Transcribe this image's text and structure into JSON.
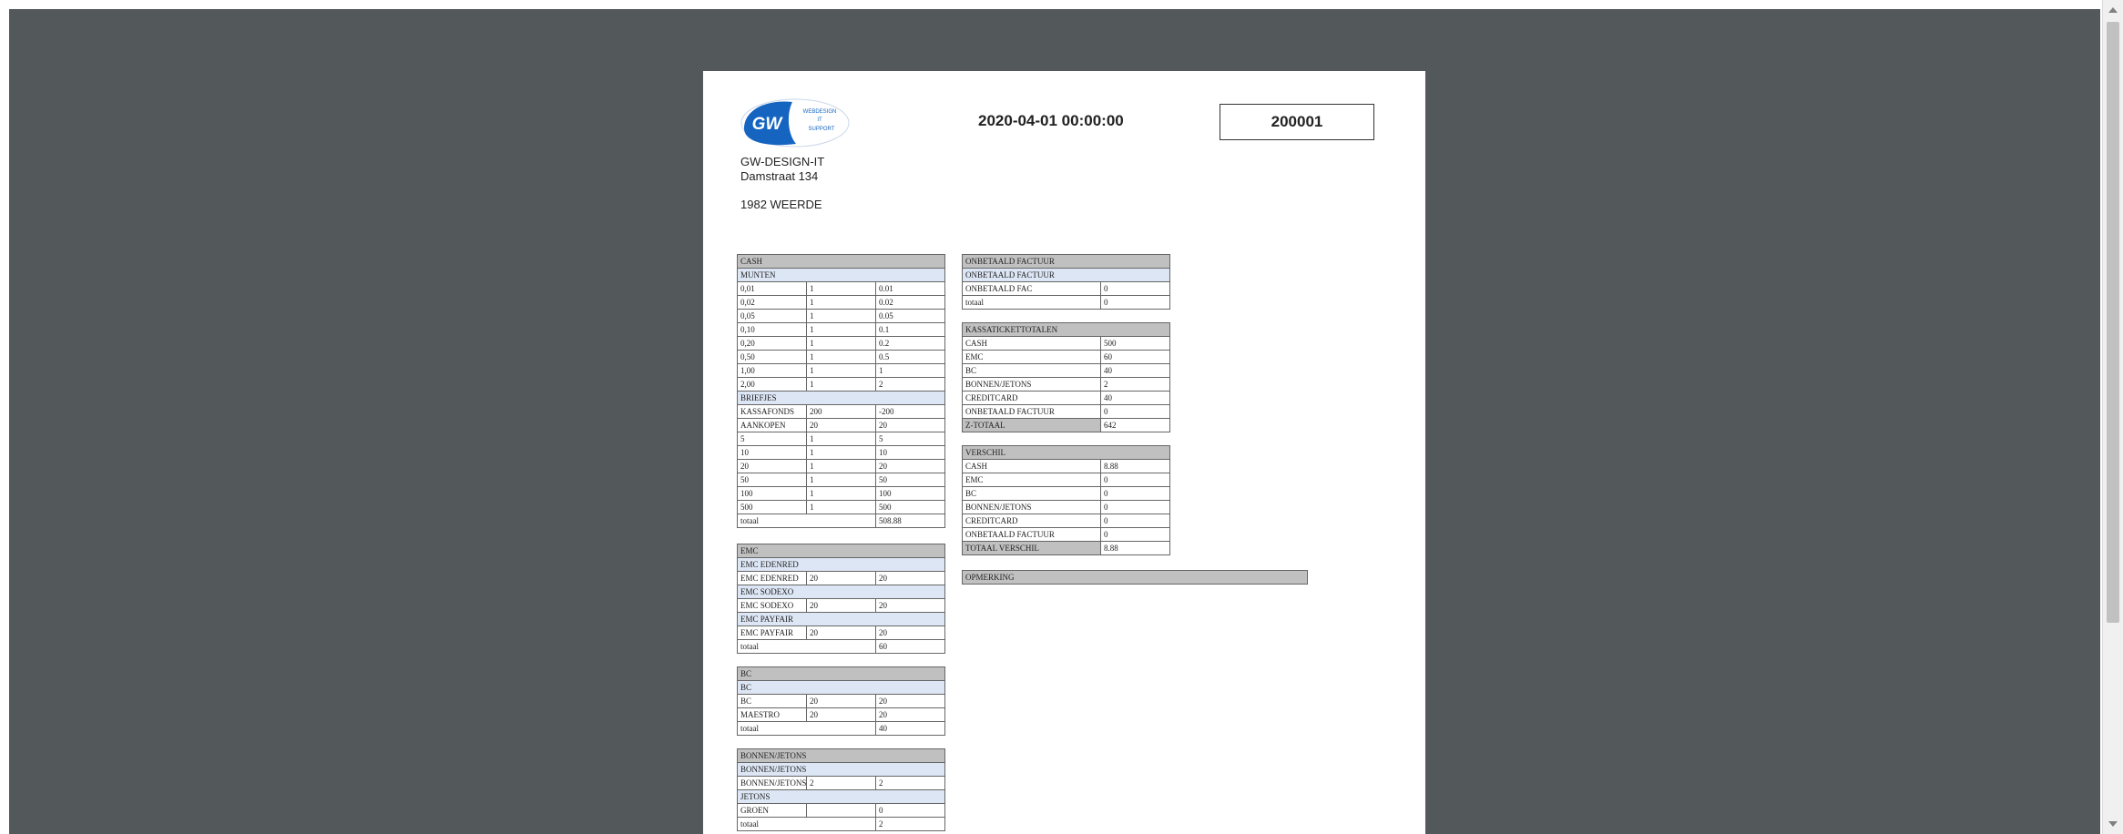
{
  "header": {
    "company": "GW-DESIGN-IT",
    "street": "Damstraat 134",
    "city": "1982 WEERDE",
    "datetime": "2020-04-01 00:00:00",
    "number": "200001"
  },
  "logo": {
    "mark": "GW",
    "line1": "WEBDESIGN",
    "line2": "IT",
    "line3": "SUPPORT",
    "color": "#1565c0"
  },
  "cash": {
    "title": "CASH",
    "munten_label": "MUNTEN",
    "munten": [
      [
        "0,01",
        "1",
        "0.01"
      ],
      [
        "0,02",
        "1",
        "0.02"
      ],
      [
        "0,05",
        "1",
        "0.05"
      ],
      [
        "0,10",
        "1",
        "0.1"
      ],
      [
        "0,20",
        "1",
        "0.2"
      ],
      [
        "0,50",
        "1",
        "0.5"
      ],
      [
        "1,00",
        "1",
        "1"
      ],
      [
        "2,00",
        "1",
        "2"
      ]
    ],
    "briefjes_label": "BRIEFJES",
    "briefjes": [
      [
        "KASSAFONDS",
        "200",
        "-200"
      ],
      [
        "AANKOPEN",
        "20",
        "20"
      ],
      [
        "5",
        "1",
        "5"
      ],
      [
        "10",
        "1",
        "10"
      ],
      [
        "20",
        "1",
        "20"
      ],
      [
        "50",
        "1",
        "50"
      ],
      [
        "100",
        "1",
        "100"
      ],
      [
        "500",
        "1",
        "500"
      ]
    ],
    "totaal_label": "totaal",
    "totaal": "508.88"
  },
  "emc": {
    "title": "EMC",
    "groups": [
      {
        "label": "EMC EDENRED",
        "row": [
          "EMC EDENRED",
          "20",
          "20"
        ]
      },
      {
        "label": "EMC SODEXO",
        "row": [
          "EMC SODEXO",
          "20",
          "20"
        ]
      },
      {
        "label": "EMC PAYFAIR",
        "row": [
          "EMC PAYFAIR",
          "20",
          "20"
        ]
      }
    ],
    "totaal_label": "totaal",
    "totaal": "60"
  },
  "bc": {
    "title": "BC",
    "sub": "BC",
    "rows": [
      [
        "BC",
        "20",
        "20"
      ],
      [
        "MAESTRO",
        "20",
        "20"
      ]
    ],
    "totaal_label": "totaal",
    "totaal": "40"
  },
  "bonnen": {
    "title": "BONNEN/JETONS",
    "sub1": "BONNEN/JETONS",
    "row1": [
      "BONNEN/JETONS",
      "2",
      "2"
    ],
    "sub2": "JETONS",
    "row2": [
      "GROEN",
      "",
      "0"
    ],
    "totaal_label": "totaal",
    "totaal": "2"
  },
  "onbetaald": {
    "title": "ONBETAALD FACTUUR",
    "sub": "ONBETAALD FACTUUR",
    "row": [
      "ONBETAALD FAC",
      "0"
    ],
    "totaal_label": "totaal",
    "totaal": "0"
  },
  "kassa": {
    "title": "KASSATICKETTOTALEN",
    "rows": [
      [
        "CASH",
        "500"
      ],
      [
        "EMC",
        "60"
      ],
      [
        "BC",
        "40"
      ],
      [
        "BONNEN/JETONS",
        "2"
      ],
      [
        "CREDITCARD",
        "40"
      ],
      [
        "ONBETAALD FACTUUR",
        "0"
      ]
    ],
    "ztotaal_label": "Z-TOTAAL",
    "ztotaal": "642"
  },
  "verschil": {
    "title": "VERSCHIL",
    "rows": [
      [
        "CASH",
        "8.88"
      ],
      [
        "EMC",
        "0"
      ],
      [
        "BC",
        "0"
      ],
      [
        "BONNEN/JETONS",
        "0"
      ],
      [
        "CREDITCARD",
        "0"
      ],
      [
        "ONBETAALD FACTUUR",
        "0"
      ]
    ],
    "totaal_label": "TOTAAL VERSCHIL",
    "totaal": "8.88"
  },
  "opmerking": {
    "title": "OPMERKING"
  }
}
